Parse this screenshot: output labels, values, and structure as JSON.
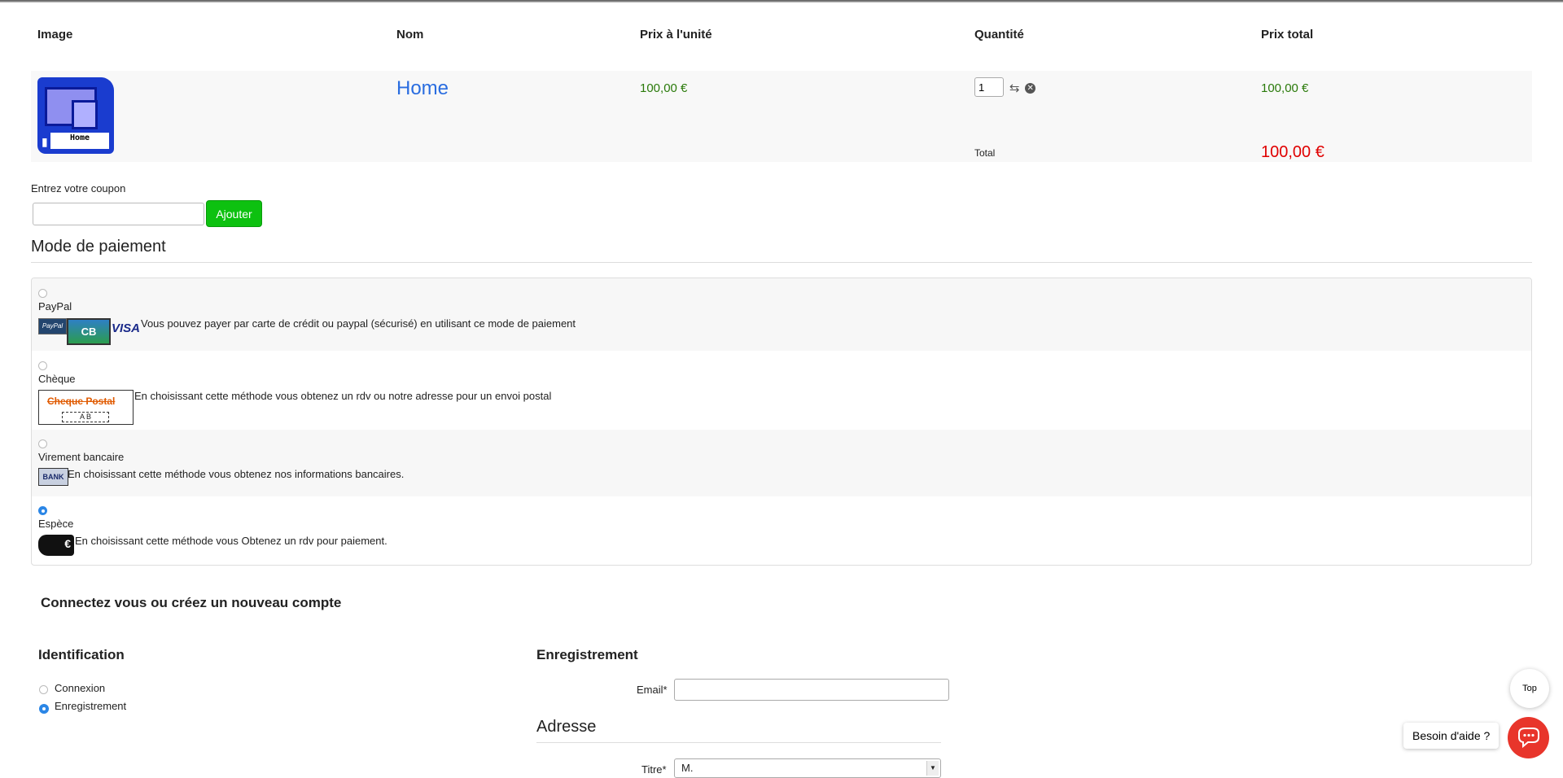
{
  "cart": {
    "headers": {
      "image": "Image",
      "nom": "Nom",
      "prix_unite": "Prix à l'unité",
      "quantite": "Quantité",
      "prix_total": "Prix total"
    },
    "item": {
      "image_label": "Home",
      "name": "Home",
      "unit_price": "100,00 €",
      "quantity": "1",
      "total": "100,00 €"
    },
    "total_label": "Total",
    "total_value": "100,00 €"
  },
  "coupon": {
    "label": "Entrez votre coupon",
    "value": "",
    "button": "Ajouter"
  },
  "payment": {
    "title": "Mode de paiement",
    "options": [
      {
        "name": "PayPal",
        "description": "Vous pouvez payer par carte de crédit ou paypal (sécurisé) en utilisant ce mode de paiement",
        "selected": false
      },
      {
        "name": "Chèque",
        "description": "En choisissant cette méthode vous obtenez un rdv ou notre adresse pour un envoi postal",
        "selected": false
      },
      {
        "name": "Virement bancaire",
        "description": "En choisissant cette méthode vous obtenez nos informations bancaires.",
        "selected": false
      },
      {
        "name": "Espèce",
        "description": "En choisissant cette méthode vous Obtenez un rdv pour paiement.",
        "selected": true
      }
    ],
    "logos": {
      "paypal": "PayPal",
      "cb": "CB",
      "visa": "VISA",
      "cheque": "Cheque Postal",
      "cheque_ab": "A  B",
      "bank": "BANK",
      "cash": "€"
    }
  },
  "account": {
    "title": "Connectez vous ou créez un nouveau compte",
    "identification": {
      "title": "Identification",
      "options": [
        "Connexion",
        "Enregistrement"
      ],
      "selected": "Enregistrement"
    },
    "registration": {
      "title": "Enregistrement",
      "email_label": "Email*",
      "email_value": ""
    },
    "address": {
      "title": "Adresse",
      "titre_label": "Titre*",
      "titre_value": "M."
    }
  },
  "widgets": {
    "top": "Top",
    "help": "Besoin d'aide ?"
  },
  "colors": {
    "link_blue": "#2a6de0",
    "price_green": "#2a7a0a",
    "total_red": "#e00000",
    "button_green": "#0dc110",
    "radio_blue": "#2b86e6",
    "chat_red": "#e8352b"
  }
}
